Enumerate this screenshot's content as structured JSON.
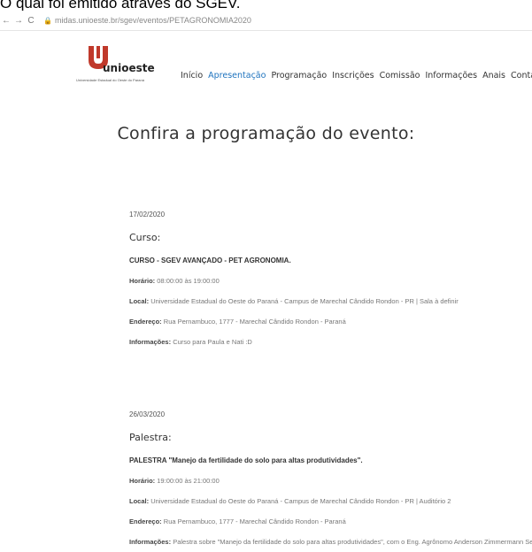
{
  "caption": {
    "text": "O qual foi emitido através do SGEV."
  },
  "browser": {
    "back": "←",
    "forward": "→",
    "reload": "C",
    "url": "midas.unioeste.br/sgev/eventos/PETAGRONOMIA2020"
  },
  "logo": {
    "name": "unioeste",
    "subtitle": "Universidade Estadual do Oeste do Paraná"
  },
  "nav": {
    "items": [
      "Início",
      "Apresentação",
      "Programação",
      "Inscrições",
      "Comissão",
      "Informações",
      "Anais",
      "Contato"
    ],
    "active": "Apresentação"
  },
  "page": {
    "title": "Confira a programação do evento:"
  },
  "events": [
    {
      "date": "17/02/2020",
      "type": "Curso:",
      "name": "CURSO - SGEV AVANÇADO - PET AGRONOMIA.",
      "horario_label": "Horário:",
      "horario": "08:00:00 às 19:00:00",
      "local_label": "Local:",
      "local": "Universidade Estadual do Oeste do Paraná - Campus de Marechal Cândido Rondon - PR | Sala à definir",
      "endereco_label": "Endereço:",
      "endereco": "Rua Pernambuco, 1777 - Marechal Cândido Rondon - Paraná",
      "info_label": "Informações:",
      "info": "Curso para Paula e Nati :D"
    },
    {
      "date": "26/03/2020",
      "type": "Palestra:",
      "name": "PALESTRA \"Manejo da fertilidade do solo para altas produtividades\".",
      "horario_label": "Horário:",
      "horario": "19:00:00 às 21:00:00",
      "local_label": "Local:",
      "local": "Universidade Estadual do Oeste do Paraná - Campus de Marechal Cândido Rondon - PR | Auditório 2",
      "endereco_label": "Endereço:",
      "endereco": "Rua Pernambuco, 1777 - Marechal Cândido Rondon - Paraná",
      "info_label": "Informações:",
      "info": "Palestra sobre \"Manejo da fertilidade do solo para altas produtividades\", com o Eng. Agrônomo Anderson Zimmermann Será no"
    }
  ],
  "colors": {
    "accent": "#1e73be",
    "logo_red": "#c0392b",
    "caption_highlight": "#e8c84a"
  }
}
